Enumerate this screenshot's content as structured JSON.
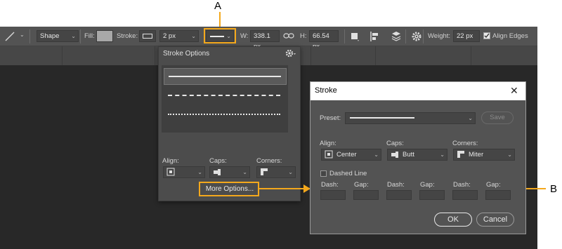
{
  "callouts": {
    "a": "A",
    "b": "B"
  },
  "optbar": {
    "tool_icon": "line-tool-icon",
    "mode": "Shape",
    "fill_label": "Fill:",
    "stroke_label": "Stroke:",
    "stroke_width": "2 px",
    "w_label": "W:",
    "w_value": "338.1 px",
    "h_label": "H:",
    "h_value": "66.54 px",
    "weight_label": "Weight:",
    "weight_value": "22 px",
    "align_edges": "Align Edges",
    "align_edges_checked": true
  },
  "panel": {
    "title": "Stroke Options",
    "align_label": "Align:",
    "caps_label": "Caps:",
    "corners_label": "Corners:",
    "more_options": "More Options..."
  },
  "dialog": {
    "title": "Stroke",
    "close_glyph": "✕",
    "preset_label": "Preset:",
    "save": "Save",
    "align_label": "Align:",
    "align_value": "Center",
    "caps_label": "Caps:",
    "caps_value": "Butt",
    "corners_label": "Corners:",
    "corners_value": "Miter",
    "dashed_line": "Dashed Line",
    "dash_gap_labels": [
      "Dash:",
      "Gap:",
      "Dash:",
      "Gap:",
      "Dash:",
      "Gap:"
    ],
    "ok": "OK",
    "cancel": "Cancel"
  },
  "colors": {
    "accent": "#f4a81c",
    "panel": "#4c4c4c",
    "canvas": "#282828",
    "toolbar": "#535353"
  }
}
